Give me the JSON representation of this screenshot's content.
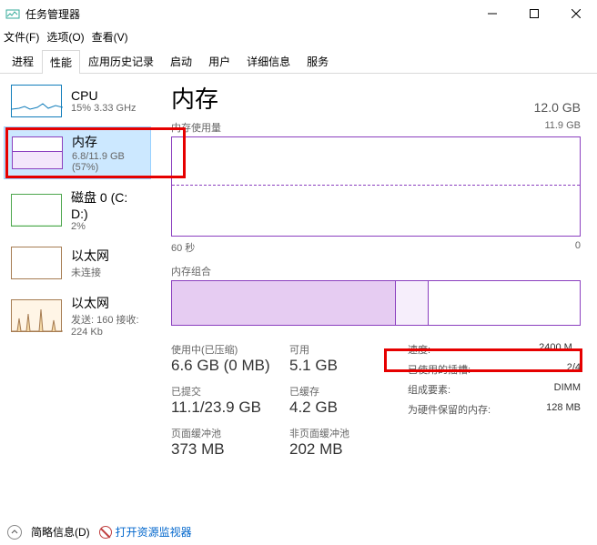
{
  "window": {
    "title": "任务管理器"
  },
  "menu": {
    "file": "文件(F)",
    "options": "选项(O)",
    "view": "查看(V)"
  },
  "tabs": [
    "进程",
    "性能",
    "应用历史记录",
    "启动",
    "用户",
    "详细信息",
    "服务"
  ],
  "active_tab": 1,
  "sidebar": [
    {
      "title": "CPU",
      "sub": "15% 3.33 GHz"
    },
    {
      "title": "内存",
      "sub": "6.8/11.9 GB (57%)"
    },
    {
      "title": "磁盘 0 (C: D:)",
      "sub": "2%"
    },
    {
      "title": "以太网",
      "sub": "未连接"
    },
    {
      "title": "以太网",
      "sub": "发送: 160 接收: 224 Kb"
    }
  ],
  "detail": {
    "title": "内存",
    "total": "12.0 GB",
    "usage_label": "内存使用量",
    "usage_max": "11.9 GB",
    "xaxis_left": "60 秒",
    "xaxis_right": "0",
    "comp_label": "内存组合",
    "stats": {
      "in_use_label": "使用中(已压缩)",
      "in_use_val": "6.6 GB (0 MB)",
      "avail_label": "可用",
      "avail_val": "5.1 GB",
      "commit_label": "已提交",
      "commit_val": "11.1/23.9 GB",
      "cached_label": "已缓存",
      "cached_val": "4.2 GB",
      "paged_label": "页面缓冲池",
      "paged_val": "373 MB",
      "nonpaged_label": "非页面缓冲池",
      "nonpaged_val": "202 MB"
    },
    "right": {
      "speed_k": "速度:",
      "speed_v": "2400 M...",
      "slots_k": "已使用的插槽:",
      "slots_v": "2/4",
      "form_k": "组成要素:",
      "form_v": "DIMM",
      "reserved_k": "为硬件保留的内存:",
      "reserved_v": "128 MB"
    }
  },
  "footer": {
    "brief": "简略信息(D)",
    "resmon": "打开资源监视器"
  }
}
